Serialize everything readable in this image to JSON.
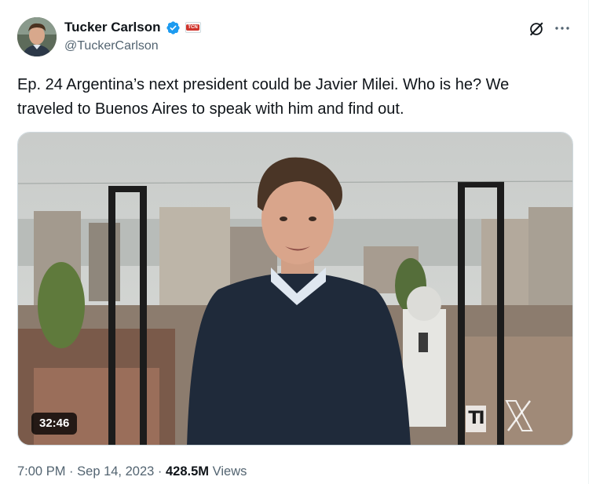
{
  "author": {
    "display_name": "Tucker Carlson",
    "handle": "@TuckerCarlson",
    "verified": true,
    "affiliate_badge": "TCN",
    "avatar_icon": "profile-photo"
  },
  "actions": {
    "grok_icon": "grok-icon",
    "more_icon": "more-icon"
  },
  "tweet": {
    "text": "Ep. 24  Argentina’s next president could be Javier Milei. Who is he? We traveled to Buenos Aires to speak with him and find out."
  },
  "media": {
    "type": "video",
    "duration": "32:46",
    "watermark_text": "TI"
  },
  "meta": {
    "time": "7:00 PM",
    "separator": "·",
    "date": "Sep 14, 2023",
    "views_count": "428.5M",
    "views_label": "Views"
  },
  "colors": {
    "text_primary": "#0f1419",
    "text_secondary": "#536471",
    "verified_blue": "#1d9bf0",
    "border": "#cfd9de"
  }
}
